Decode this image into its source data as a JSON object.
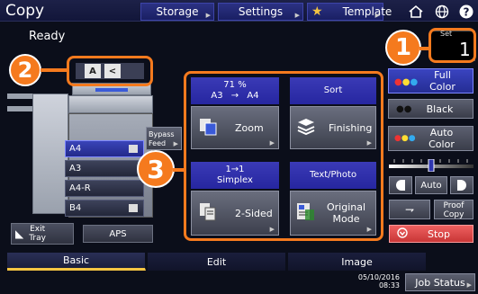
{
  "header": {
    "title": "Copy",
    "storage_label": "Storage",
    "settings_label": "Settings",
    "template_label": "Template"
  },
  "status": "Ready",
  "set": {
    "label": "Set",
    "value": "1"
  },
  "original_icons": {
    "first": "A",
    "second": "<"
  },
  "bypass_label_1": "Bypass",
  "bypass_label_2": "Feed",
  "trays": [
    "A4",
    "A3",
    "A4-R",
    "B4"
  ],
  "exit_tray": {
    "line1": "Exit",
    "line2": "Tray"
  },
  "aps_label": "APS",
  "zoom": {
    "percent": "71 %",
    "from": "A3",
    "arrow": "→",
    "to": "A4",
    "label": "Zoom"
  },
  "finishing": {
    "head": "Sort",
    "label": "Finishing"
  },
  "two_sided": {
    "head1": "1→1",
    "head2": "Simplex",
    "label": "2-Sided"
  },
  "original_mode": {
    "head": "Text/Photo",
    "label1": "Original",
    "label2": "Mode"
  },
  "color": {
    "full_1": "Full",
    "full_2": "Color",
    "black": "Black",
    "auto_1": "Auto",
    "auto_2": "Color"
  },
  "density_auto": "Auto",
  "proof_copy": {
    "line1": "Proof",
    "line2": "Copy"
  },
  "stop_label": "Stop",
  "tabs": [
    "Basic",
    "Edit",
    "Image"
  ],
  "footer": {
    "date": "05/10/2016",
    "time": "08:33",
    "job_status": "Job Status"
  },
  "callouts": [
    "1",
    "2",
    "3"
  ],
  "colors": {
    "accent_orange": "#f57a1e",
    "active_blue": "#2d35b0",
    "stop_red": "#e04848"
  }
}
